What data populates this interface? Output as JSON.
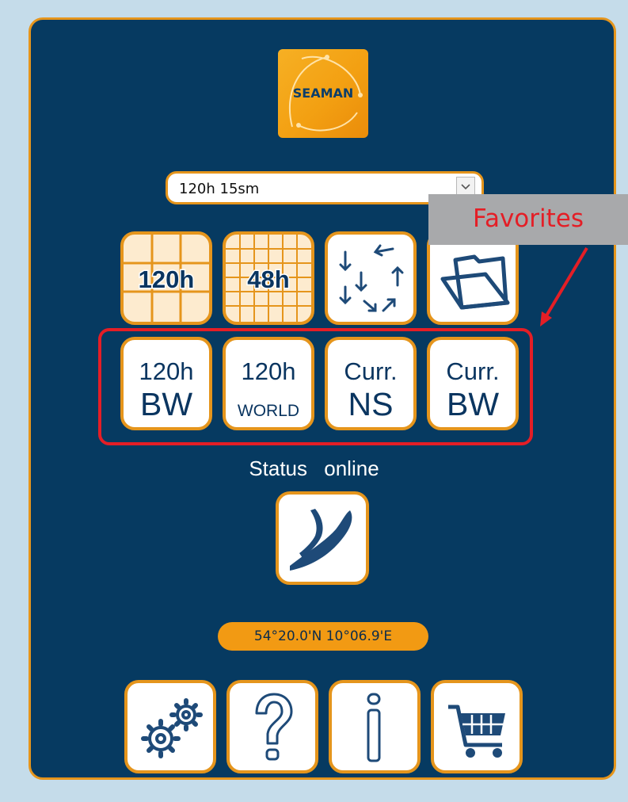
{
  "app": {
    "logo_text": "SEAMAN"
  },
  "forecast_select": {
    "value": "120h 15sm"
  },
  "toolbar": {
    "grid120_label": "120h",
    "grid48_label": "48h",
    "wind_arrows_icon": "wind-arrows-icon",
    "folder_icon": "folder-icon"
  },
  "favorites": {
    "items": [
      {
        "line1": "120h",
        "line2": "BW"
      },
      {
        "line1": "120h",
        "line2": "WORLD"
      },
      {
        "line1": "Curr.",
        "line2": "NS"
      },
      {
        "line1": "Curr.",
        "line2": "BW"
      }
    ]
  },
  "status": {
    "label": "Status",
    "value": "online"
  },
  "position": {
    "coordinates": "54°20.0'N 10°06.9'E"
  },
  "bottom_bar": {
    "icons": [
      "settings-gears-icon",
      "help-question-icon",
      "info-icon",
      "shopping-cart-icon"
    ]
  },
  "annotation": {
    "label": "Favorites",
    "color": "#e41e26"
  },
  "colors": {
    "panel": "#063a61",
    "accent": "#e5951c",
    "background": "#c5dcea"
  }
}
